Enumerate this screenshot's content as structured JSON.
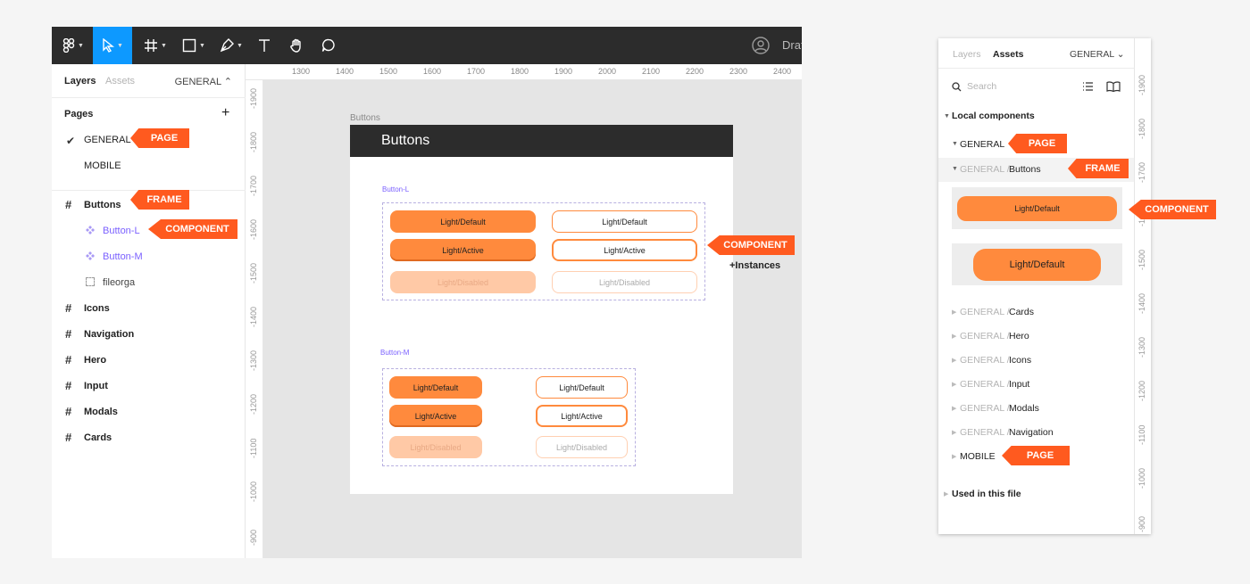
{
  "toolbar": {
    "draft_label": "Draf"
  },
  "left_panel": {
    "tab_layers": "Layers",
    "tab_assets": "Assets",
    "page_selector": "GENERAL ⌃",
    "pages_heading": "Pages",
    "add_page": "+",
    "pages": [
      "GENERAL",
      "MOBILE"
    ],
    "layers": {
      "frame_buttons": "Buttons",
      "component_l": "Button-L",
      "component_m": "Button-M",
      "fileorga": "fileorga",
      "frames": [
        "Icons",
        "Navigation",
        "Hero",
        "Input",
        "Modals",
        "Cards"
      ]
    }
  },
  "annotations": {
    "page": "PAGE",
    "frame": "FRAME",
    "component": "COMPONENT",
    "instances": "+Instances"
  },
  "rulers": {
    "top": [
      "1300",
      "1400",
      "1500",
      "1600",
      "1700",
      "1800",
      "1900",
      "2000",
      "2100",
      "2200",
      "2300",
      "2400"
    ],
    "left": [
      "-1900",
      "-1800",
      "-1700",
      "-1600",
      "-1500",
      "-1400",
      "-1300",
      "-1200",
      "-1100",
      "-1000",
      "-900"
    ],
    "right_panel": [
      "-1900",
      "-1800",
      "-1700",
      "-1600",
      "-1500",
      "-1400",
      "-1300",
      "-1200",
      "-1100",
      "-1000",
      "-900"
    ]
  },
  "canvas": {
    "frame_name": "Buttons",
    "frame_title": "Buttons",
    "group_l_label": "Button-L",
    "group_m_label": "Button-M",
    "buttons": {
      "light_default": "Light/Default",
      "light_active": "Light/Active",
      "light_disabled": "Light/Disabled"
    }
  },
  "assets_panel": {
    "tab_layers": "Layers",
    "tab_assets": "Assets",
    "page_selector": "GENERAL ⌄",
    "search_placeholder": "Search",
    "local_components": "Local components",
    "general": "GENERAL",
    "general_buttons_prefix": "GENERAL /",
    "general_buttons_name": "Buttons",
    "preview_1": "Light/Default",
    "preview_2": "Light/Default",
    "groups": [
      {
        "prefix": "GENERAL /",
        "name": "Cards"
      },
      {
        "prefix": "GENERAL /",
        "name": "Hero"
      },
      {
        "prefix": "GENERAL /",
        "name": "Icons"
      },
      {
        "prefix": "GENERAL /",
        "name": "Input"
      },
      {
        "prefix": "GENERAL /",
        "name": "Modals"
      },
      {
        "prefix": "GENERAL /",
        "name": "Navigation"
      }
    ],
    "mobile": "MOBILE",
    "used_in_file": "Used in this file"
  },
  "colors": {
    "toolbar_bg": "#2c2c2c",
    "active_tool": "#0d99ff",
    "annotation_tag": "#ff5a1f",
    "button_orange": "#ff8a3d",
    "component_purple": "#7b61ff"
  }
}
